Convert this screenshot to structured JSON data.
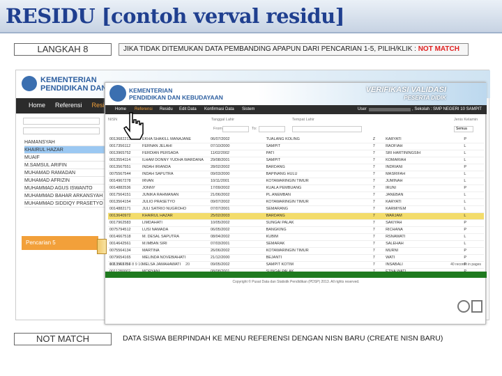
{
  "banner": {
    "title": "RESIDU [contoh verval residu]"
  },
  "steps": [
    {
      "tag": "LANGKAH 8",
      "instruction_prefix": "JIKA TIDAK DITEMUKAN DATA PEMBANDING APAPUN DARI PENCARIAN 1-5, PILIH/KLIK : ",
      "instruction_highlight": "NOT MATCH"
    },
    {
      "tag": "NOT MATCH",
      "instruction_prefix": "DATA SISWA BERPINDAH KE MENU REFERENSI DENGAN NISN BARU (CREATE NISN BARU)",
      "instruction_highlight": ""
    }
  ],
  "back_app": {
    "org": "KEMENTERIAN PENDIDIKAN DAN",
    "nav": [
      "Home",
      "Referensi",
      "Residu"
    ],
    "names": [
      "HAMANSYAH",
      "KHAIRUL HAZAR",
      "MUAIF",
      "M.SAMSUL ARIFIN",
      "MUHAMAD RAMADAN",
      "MUHAMAD AFRIZIN",
      "MUHAMMAD AGUS ISWANTO",
      "MUHAMMAD BAHAR ARKANSYAH",
      "MUHAMMAD SIDDIQY PRASETYO"
    ],
    "selected_index": 1,
    "panel": "Pencarian 5"
  },
  "front_app": {
    "org_line1": "KEMENTERIAN",
    "org_line2": "PENDIDIKAN DAN KEBUDAYAAN",
    "verif": "VERIFIKASI VALIDASI",
    "verif_sub": "PESERTA DIDIK",
    "nav": [
      "Home",
      "Referensi",
      "Residu",
      "Edit Data",
      "Konfirmasi Data",
      "Sistem"
    ],
    "user": "User",
    "school": ", Sekolah : SMP NEGERI 10 SAMPIT",
    "filters": [
      "NISN",
      "Tanggal Lahir",
      "Tempat Lahir",
      "Jenis Kelamin"
    ],
    "from": "From:",
    "to": "To:",
    "select": "Semua",
    "rows": [
      [
        "0013682213",
        "EKHA SHAKILL MANAJANE",
        "06/07/2002",
        "TUALANG KOLING",
        "Z",
        "KARYATI",
        "P"
      ],
      [
        "0017356112",
        "FERNAN JELAHI",
        "07/10/2000",
        "SAMPIT",
        "7",
        "RAOFIAH",
        "L"
      ],
      [
        "0013965752",
        "FERDIAN PERSADA",
        "11/02/2002",
        "PATI",
        "7",
        "SRI HARTININGSIH",
        "L"
      ],
      [
        "0013554114",
        "ILHAM DONNY YUDHA WARDANA",
        "29/08/2001",
        "SAMPIT",
        "7",
        "KOMARIAH",
        "L"
      ],
      [
        "0013567551",
        "INDAH IRIANDA",
        "28/02/2002",
        "BARDANG",
        "7",
        "INDRIANI",
        "P"
      ],
      [
        "0075567544",
        "INDAH SAPUTRA",
        "09/03/2000",
        "BAPINANG HULU",
        "7",
        "MASRIFAH",
        "L"
      ],
      [
        "0014967278",
        "IRVAN",
        "10/11/2001",
        "KOTAWARINGIN TIMUR",
        "7",
        "JUMINAH",
        "L"
      ],
      [
        "0014882536",
        "JONNY",
        "17/09/2002",
        "KUALA PEMBUANG",
        "7",
        "IRUNI",
        "P"
      ],
      [
        "0017564151",
        "JUNIKA RAHMANAN",
        "21/06/2002",
        "PL.ANEMBAN",
        "7",
        "JANEBAN",
        "L"
      ],
      [
        "0013564154",
        "JULIO PRASETYO",
        "09/07/2002",
        "KOTAWARINGIN TIMUR",
        "7",
        "KARYATI",
        "L"
      ],
      [
        "0014882171",
        "JULI SATRIO NUGROHO",
        "07/07/2001",
        "SEMARANG",
        "7",
        "KARMIYEM",
        "L"
      ],
      [
        "0013640972",
        "KHAIRUL HAZAR",
        "25/02/2003",
        "BARDANG",
        "7",
        "WARJAM",
        "L"
      ],
      [
        "0017962583",
        "LIMDAHATI",
        "10/05/2002",
        "SUNGAI PALAK",
        "7",
        "SAKIYAH",
        "P"
      ],
      [
        "0075794512",
        "LUSI NAMADA",
        "06/05/2002",
        "BANGKING",
        "7",
        "RICHANA",
        "P"
      ],
      [
        "0014667518",
        "M. DESAL SAPUTRA",
        "08/04/2002",
        "KUBIM",
        "7",
        "RSNAWATI",
        "L"
      ],
      [
        "0014642561",
        "M.IMBAN SIRI",
        "07/03/2001",
        "SEMARAK",
        "7",
        "SALEHAH",
        "L"
      ],
      [
        "0075564134",
        "MARTINA",
        "26/06/2002",
        "KOTAWARINGIN TIMUR",
        "7",
        "MURNI",
        "P"
      ],
      [
        "0079654165",
        "MELINDA NOVEBIAHATI",
        "21/12/2000",
        "BEJANTI",
        "7",
        "WATI",
        "P"
      ],
      [
        "0013562756",
        "MELSA JAMAHAWATI",
        "09/05/2002",
        "SAMPIT KOTIM",
        "7",
        "INSABALI",
        "P"
      ],
      [
        "0011280002",
        "MORYANI",
        "08/08/2001",
        "SUNGAI PALAK",
        "7",
        "ETNA WATI",
        "P"
      ]
    ],
    "selected_row": 11,
    "pager": "1 2 3 4 5 6 7 8 9 10",
    "page_size": "20",
    "records": "40 records in pages",
    "copyright": "Copyright © Pusat Data dan Statistik Pendidikan (PDSP) 2013. All rights reserved."
  },
  "colors": {
    "title": "#1f3f8f",
    "highlight": "#e02020",
    "selected_row": "#f3dc6b",
    "nav": "#2d2d2d",
    "footer_green": "#1f7a1f"
  }
}
